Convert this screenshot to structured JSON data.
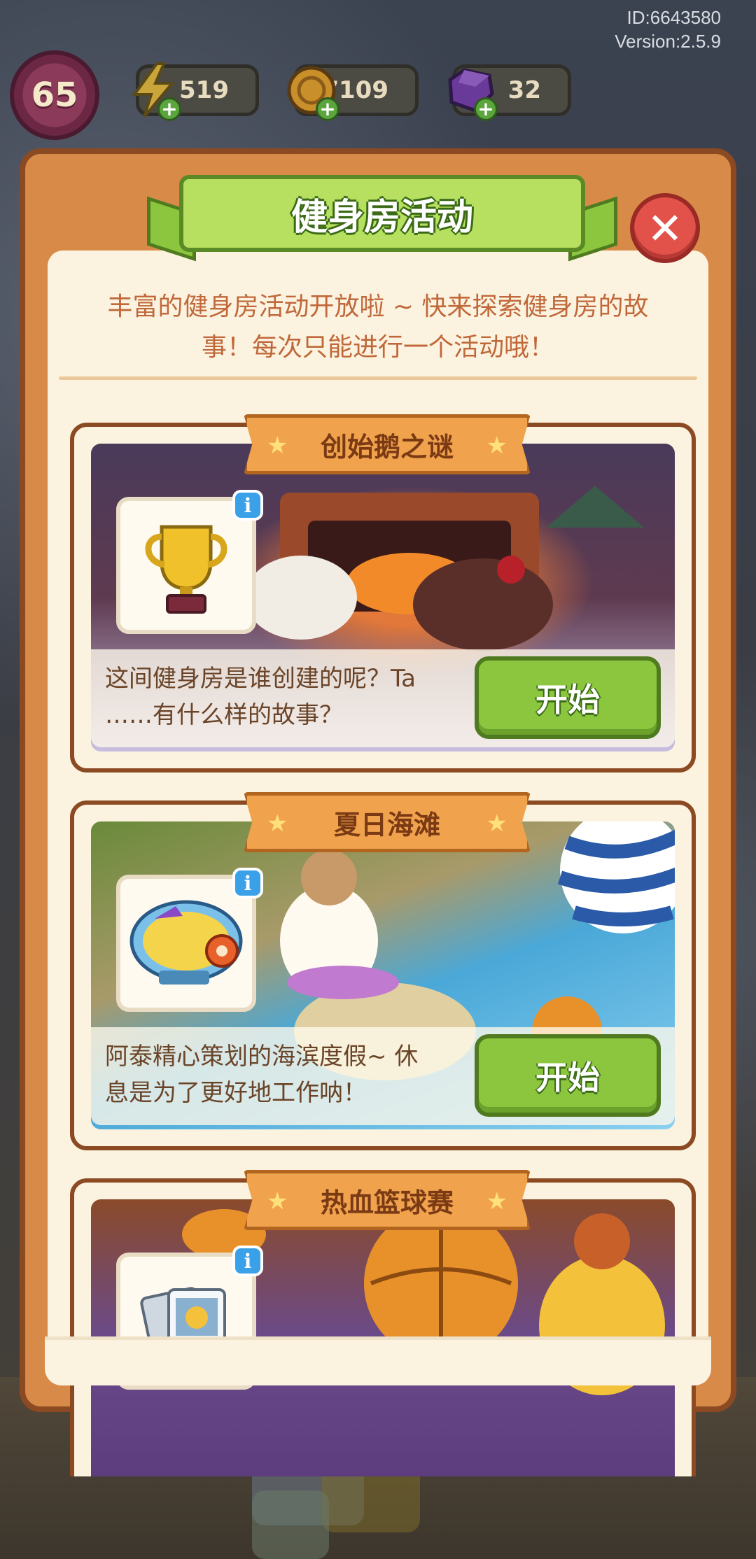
{
  "version_info": {
    "id": "ID:6643580",
    "version": "Version:2.5.9"
  },
  "status_bar": {
    "level": "65",
    "energy": {
      "icon": "lightning-icon",
      "value": "519"
    },
    "coins": {
      "icon": "coin-icon",
      "value": "7109"
    },
    "gems": {
      "icon": "gem-icon",
      "value": "32"
    }
  },
  "dialog": {
    "title": "健身房活动",
    "intro_line1": "丰富的健身房活动开放啦 ~ 快来探索健身房的故",
    "intro_line2": "事！每次只能进行一个活动哦！"
  },
  "events": [
    {
      "name": "创始鹅之谜",
      "icon": "trophy-icon",
      "desc_line1": "这间健身房是谁创建的呢？Ta",
      "desc_line2": "……有什么样的故事？",
      "button": "开始"
    },
    {
      "name": "夏日海滩",
      "icon": "fatgoose-gym-logo",
      "desc_line1": "阿泰精心策划的海滨度假~ 休",
      "desc_line2": "息是为了更好地工作呐！",
      "button": "开始"
    },
    {
      "name": "热血篮球赛",
      "icon": "trading-card-icon"
    }
  ],
  "colors": {
    "panel": "#d88a48",
    "panel_border": "#8b4a22",
    "cream": "#fbf3df",
    "green_button": "#8cc63f",
    "close_red": "#e2514a",
    "info_blue": "#3aa0e8"
  }
}
